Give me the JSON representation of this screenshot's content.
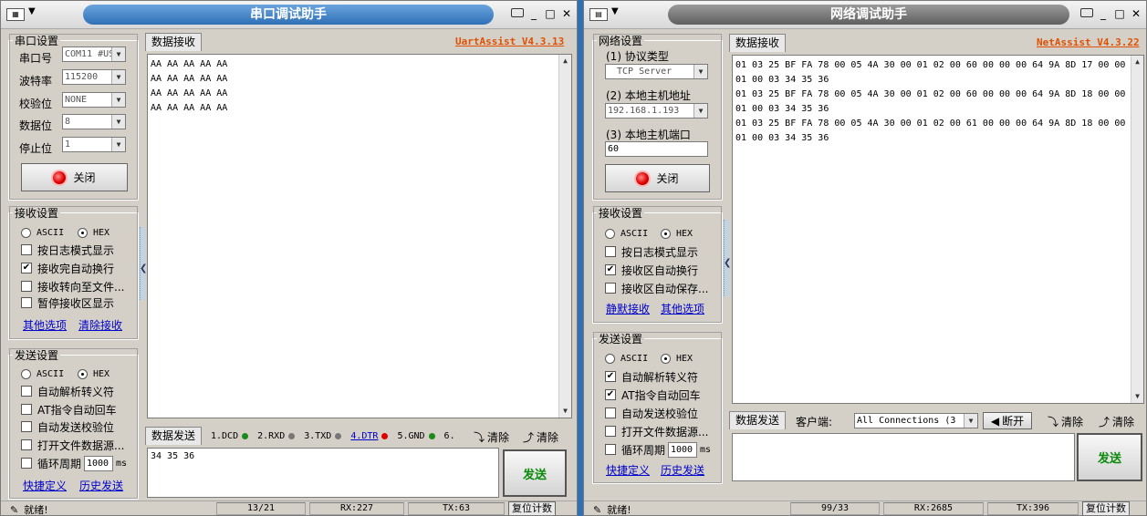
{
  "uart": {
    "title": "串口调试助手",
    "version": "UartAssist V4.3.13",
    "serial_settings": {
      "legend": "串口设置",
      "port": {
        "label": "串口号",
        "value": "COM11 #US"
      },
      "baud": {
        "label": "波特率",
        "value": "115200"
      },
      "parity": {
        "label": "校验位",
        "value": "NONE"
      },
      "databits": {
        "label": "数据位",
        "value": "8"
      },
      "stopbits": {
        "label": "停止位",
        "value": "1"
      },
      "close_label": "关闭"
    },
    "recv_settings": {
      "legend": "接收设置",
      "ascii": "ASCII",
      "hex": "HEX",
      "opts": [
        "按日志模式显示",
        "接收完自动换行",
        "接收转向至文件...",
        "暂停接收区显示"
      ],
      "checked": [
        false,
        true,
        false,
        false
      ],
      "link1": "其他选项",
      "link2": "清除接收"
    },
    "send_settings": {
      "legend": "发送设置",
      "ascii": "ASCII",
      "hex": "HEX",
      "opts": [
        "自动解析转义符",
        "AT指令自动回车",
        "自动发送校验位",
        "打开文件数据源..."
      ],
      "checked": [
        false,
        false,
        false,
        false
      ],
      "cycle_label": "循环周期",
      "cycle_value": "1000",
      "cycle_unit": "ms",
      "link1": "快捷定义",
      "link2": "历史发送"
    },
    "recv_tab": "数据接收",
    "recv_lines": [
      "AA AA AA AA AA",
      "AA AA AA AA AA",
      "AA AA AA AA AA",
      "AA AA AA AA AA"
    ],
    "send_tab": "数据发送",
    "pins": [
      {
        "label": "1.DCD",
        "color": "#1a8a1a"
      },
      {
        "label": "2.RXD",
        "color": "#777"
      },
      {
        "label": "3.TXD",
        "color": "#777"
      },
      {
        "label": "4.DTR",
        "color": "#d00"
      },
      {
        "label": "5.GND",
        "color": "#1a8a1a"
      },
      {
        "label": "6.",
        "color": ""
      }
    ],
    "clear1": "清除",
    "clear2": "清除",
    "send_text": "34 35 36",
    "send_btn": "发送",
    "status": {
      "ready": "就绪!",
      "count": "13/21",
      "rx": "RX:227",
      "tx": "TX:63",
      "reset": "复位计数"
    }
  },
  "net": {
    "title": "网络调试助手",
    "version": "NetAssist V4.3.22",
    "net_settings": {
      "legend": "网络设置",
      "proto_label": "(1) 协议类型",
      "proto_value": "TCP Server",
      "host_label": "(2) 本地主机地址",
      "host_value": "192.168.1.193",
      "port_label": "(3) 本地主机端口",
      "port_value": "60",
      "close_label": "关闭"
    },
    "recv_settings": {
      "legend": "接收设置",
      "ascii": "ASCII",
      "hex": "HEX",
      "opts": [
        "按日志模式显示",
        "接收区自动换行",
        "接收区自动保存..."
      ],
      "checked": [
        false,
        true,
        false
      ],
      "link1": "静默接收",
      "link2": "其他选项"
    },
    "send_settings": {
      "legend": "发送设置",
      "ascii": "ASCII",
      "hex": "HEX",
      "opts": [
        "自动解析转义符",
        "AT指令自动回车",
        "自动发送校验位",
        "打开文件数据源..."
      ],
      "checked": [
        true,
        true,
        false,
        false
      ],
      "cycle_label": "循环周期",
      "cycle_value": "1000",
      "cycle_unit": "ms",
      "link1": "快捷定义",
      "link2": "历史发送"
    },
    "recv_tab": "数据接收",
    "recv_lines": [
      "01 03 25 BF FA 78 00 05 4A 30 00 01 02 00 60 00 00 00 64 9A 8D 17 00 00",
      "01 00 03 34 35 36",
      "01 03 25 BF FA 78 00 05 4A 30 00 01 02 00 60 00 00 00 64 9A 8D 18 00 00",
      "01 00 03 34 35 36",
      "01 03 25 BF FA 78 00 05 4A 30 00 01 02 00 61 00 00 00 64 9A 8D 18 00 00",
      "01 00 03 34 35 36"
    ],
    "send_tab": "数据发送",
    "client_label": "客户端:",
    "client_value": "All Connections (3",
    "disconnect": "断开",
    "clear1": "清除",
    "clear2": "清除",
    "send_btn": "发送",
    "status": {
      "ready": "就绪!",
      "count": "99/33",
      "rx": "RX:2685",
      "tx": "TX:396",
      "reset": "复位计数"
    }
  }
}
